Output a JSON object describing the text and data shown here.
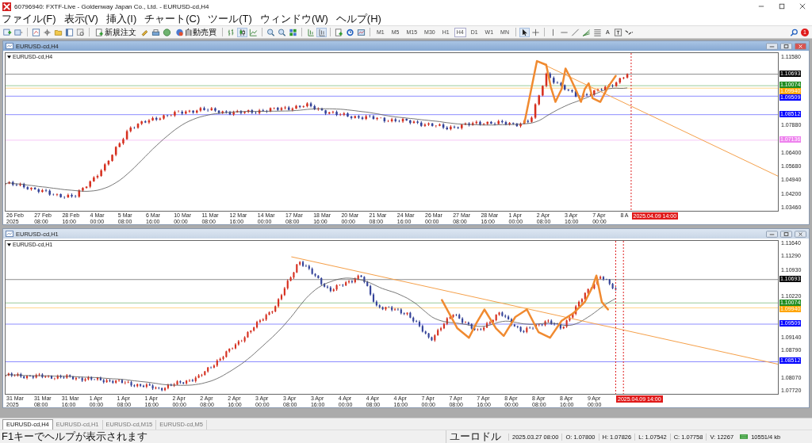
{
  "window": {
    "title": "60796940: FXTF-Live - Goldenway Japan Co., Ltd. - EURUSD-cd,H4"
  },
  "menu": [
    "ファイル(F)",
    "表示(V)",
    "挿入(I)",
    "チャート(C)",
    "ツール(T)",
    "ウィンドウ(W)",
    "ヘルプ(H)"
  ],
  "toolbar": {
    "order_button": "新規注文",
    "auto_trading_button": "自動売買",
    "text_tool": "A",
    "timeframes": [
      {
        "label": "M1",
        "selected": false
      },
      {
        "label": "M5",
        "selected": false
      },
      {
        "label": "M15",
        "selected": false
      },
      {
        "label": "M30",
        "selected": false
      },
      {
        "label": "H1",
        "selected": false
      },
      {
        "label": "H4",
        "selected": true
      },
      {
        "label": "D1",
        "selected": false
      },
      {
        "label": "W1",
        "selected": false
      },
      {
        "label": "MN",
        "selected": false
      }
    ],
    "notification_count": "1"
  },
  "charts": [
    {
      "window_title": "EURUSD-cd,H4",
      "active": true,
      "symbol_label": "EURUSD-cd,H4",
      "price_ticks": [
        "1.11580",
        "1.07880",
        "1.06400",
        "1.05680",
        "1.04940",
        "1.04200",
        "1.03460"
      ],
      "levels": [
        {
          "text": "1.10693",
          "color": "#000000"
        },
        {
          "text": "1.10074",
          "color": "#1e8c1e"
        },
        {
          "text": "1.09940",
          "color": "#ffa500"
        },
        {
          "text": "1.09509",
          "color": "#0000ff"
        },
        {
          "text": "1.08512",
          "color": "#0000ff"
        },
        {
          "text": "1.07136",
          "color": "#ee82ee"
        }
      ],
      "time_labels": [
        "26 Feb 2025",
        "27 Feb 08:00",
        "28 Feb 16:00",
        "4 Mar 00:00",
        "5 Mar 08:00",
        "6 Mar 16:00",
        "10 Mar 00:00",
        "11 Mar 08:00",
        "12 Mar 16:00",
        "14 Mar 00:00",
        "17 Mar 08:00",
        "18 Mar 16:00",
        "20 Mar 00:00",
        "21 Mar 08:00",
        "24 Mar 16:00",
        "26 Mar 00:00",
        "27 Mar 08:00",
        "28 Mar 16:00",
        "1 Apr 00:00",
        "2 Apr 08:00",
        "3 Apr 16:00",
        "7 Apr 00:00",
        "8 A"
      ],
      "cursor_label": "2025.04.09 14:00"
    },
    {
      "window_title": "EURUSD-cd,H1",
      "active": false,
      "symbol_label": "EURUSD-cd,H1",
      "price_ticks": [
        "1.11640",
        "1.11290",
        "1.10930",
        "1.10220",
        "1.09140",
        "1.08790",
        "1.08070",
        "1.07720"
      ],
      "levels": [
        {
          "text": "1.10693",
          "color": "#000000"
        },
        {
          "text": "1.10074",
          "color": "#1e8c1e"
        },
        {
          "text": "1.09940",
          "color": "#ffa500"
        },
        {
          "text": "1.09509",
          "color": "#0000ff"
        },
        {
          "text": "1.08512",
          "color": "#0000ff"
        }
      ],
      "time_labels": [
        "31 Mar 2025",
        "31 Mar 08:00",
        "31 Mar 16:00",
        "1 Apr 00:00",
        "1 Apr 08:00",
        "1 Apr 16:00",
        "2 Apr 00:00",
        "2 Apr 08:00",
        "2 Apr 16:00",
        "3 Apr 00:00",
        "3 Apr 08:00",
        "3 Apr 16:00",
        "4 Apr 00:00",
        "4 Apr 08:00",
        "4 Apr 16:00",
        "7 Apr 00:00",
        "7 Apr 08:00",
        "7 Apr 16:00",
        "8 Apr 00:00",
        "8 Apr 08:00",
        "8 Apr 16:00",
        "9 Apr 00:00"
      ],
      "cursor_label": "2025.04.09 14:00"
    }
  ],
  "tabs": [
    {
      "label": "EURUSD-cd,H4",
      "selected": true
    },
    {
      "label": "EURUSD-cd,H1",
      "selected": false
    },
    {
      "label": "EURUSD-cd,M15",
      "selected": false
    },
    {
      "label": "EURUSD-cd,M5",
      "selected": false
    }
  ],
  "status_bar": {
    "help": "F1キーでヘルプが表示されます",
    "symbol": "ユーロドル",
    "time": "2025.03.27 08:00",
    "open": "O: 1.07800",
    "high": "H: 1.07826",
    "low": "L: 1.07542",
    "close": "C: 1.07758",
    "volume": "V: 12267",
    "traffic": "10551/4 kb"
  }
}
